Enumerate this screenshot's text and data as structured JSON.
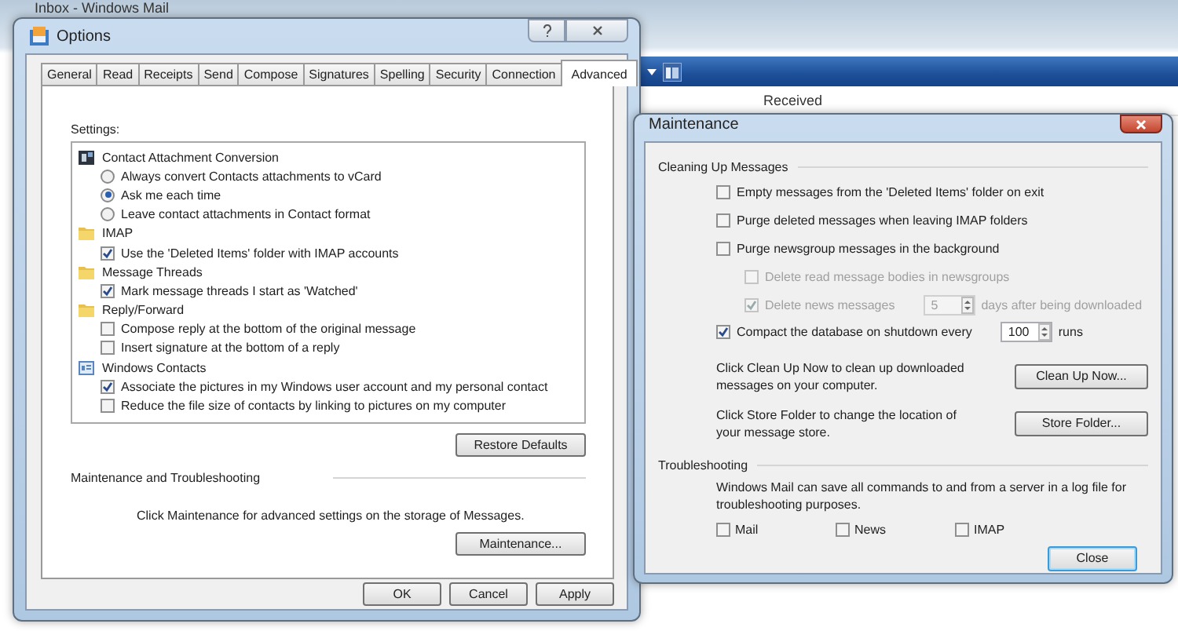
{
  "background_window": {
    "title": "Inbox - Windows Mail",
    "column_header": "Received"
  },
  "options": {
    "title": "Options",
    "tabs": [
      {
        "label": "General",
        "selected": false
      },
      {
        "label": "Read",
        "selected": false
      },
      {
        "label": "Receipts",
        "selected": false
      },
      {
        "label": "Send",
        "selected": false
      },
      {
        "label": "Compose",
        "selected": false
      },
      {
        "label": "Signatures",
        "selected": false
      },
      {
        "label": "Spelling",
        "selected": false
      },
      {
        "label": "Security",
        "selected": false
      },
      {
        "label": "Connection",
        "selected": false
      },
      {
        "label": "Advanced",
        "selected": true
      }
    ],
    "settings_label": "Settings:",
    "groups": [
      {
        "kind": "attachment",
        "title": "Contact Attachment Conversion",
        "items": [
          {
            "kind": "radio",
            "label": "Always convert Contacts attachments to vCard",
            "selected": false
          },
          {
            "kind": "radio",
            "label": "Ask me each time",
            "selected": true
          },
          {
            "kind": "radio",
            "label": "Leave contact attachments in Contact format",
            "selected": false
          }
        ]
      },
      {
        "kind": "folder",
        "title": "IMAP",
        "items": [
          {
            "kind": "checkbox",
            "label": "Use the 'Deleted Items' folder with IMAP accounts",
            "checked": true
          }
        ]
      },
      {
        "kind": "folder",
        "title": "Message Threads",
        "items": [
          {
            "kind": "checkbox",
            "label": "Mark message threads I start as 'Watched'",
            "checked": true
          }
        ]
      },
      {
        "kind": "folder",
        "title": "Reply/Forward",
        "items": [
          {
            "kind": "checkbox",
            "label": "Compose reply at the bottom of the original message",
            "checked": false
          },
          {
            "kind": "checkbox",
            "label": "Insert signature at the bottom of a reply",
            "checked": false
          }
        ]
      },
      {
        "kind": "contacts",
        "title": "Windows Contacts",
        "items": [
          {
            "kind": "checkbox",
            "label": "Associate the pictures in my Windows user account and my personal contact",
            "checked": true
          },
          {
            "kind": "checkbox",
            "label": "Reduce the file size of contacts by linking to pictures on my computer",
            "checked": false
          }
        ]
      }
    ],
    "restore_button": "Restore Defaults",
    "section_title": "Maintenance and Troubleshooting",
    "description": "Click Maintenance for advanced settings on the storage of Messages.",
    "maintenance_button": "Maintenance...",
    "buttons": [
      "OK",
      "Cancel",
      "Apply"
    ]
  },
  "maintenance": {
    "title": "Maintenance",
    "cleaning_title": "Cleaning Up Messages",
    "options": [
      {
        "label": "Empty messages from the 'Deleted Items' folder on exit",
        "checked": false,
        "disabled": false
      },
      {
        "label": "Purge deleted messages when leaving IMAP folders",
        "checked": false,
        "disabled": false
      },
      {
        "label": "Purge newsgroup messages in the background",
        "checked": false,
        "disabled": false,
        "children": [
          {
            "label": "Delete read message bodies in newsgroups",
            "checked": false,
            "disabled": true
          },
          {
            "label": "Delete news messages",
            "checked": true,
            "disabled": true,
            "spinner": "5",
            "suffix": "days after being downloaded"
          }
        ]
      },
      {
        "label": "Compact the database on shutdown every",
        "checked": true,
        "disabled": false,
        "spinner": "100",
        "suffix": "runs"
      }
    ],
    "actions": [
      {
        "text": "Click Clean Up Now to clean up downloaded messages on your computer.",
        "button": "Clean Up Now..."
      },
      {
        "text": "Click Store Folder to change the location of your message store.",
        "button": "Store Folder..."
      }
    ],
    "troubleshooting_title": "Troubleshooting",
    "troubleshooting_text": "Windows Mail can save all commands to and from a server in a log file for troubleshooting purposes.",
    "logs": [
      {
        "label": "Mail",
        "checked": false
      },
      {
        "label": "News",
        "checked": false
      },
      {
        "label": "IMAP",
        "checked": false
      }
    ],
    "close_button": "Close"
  }
}
